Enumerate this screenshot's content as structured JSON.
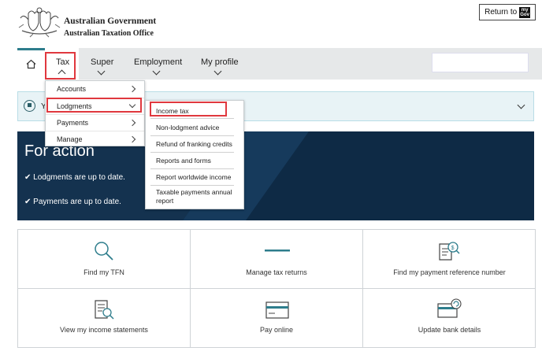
{
  "header": {
    "gov_line1": "Australian Government",
    "gov_line2": "Australian Taxation Office",
    "return_label": "Return to",
    "mygov_line1": "my",
    "mygov_line2": "Gov"
  },
  "nav": {
    "home_icon": "home-icon",
    "items": [
      {
        "label": "Tax"
      },
      {
        "label": "Super"
      },
      {
        "label": "Employment"
      },
      {
        "label": "My profile"
      }
    ],
    "search_value": ""
  },
  "alert": {
    "text": "Y"
  },
  "hero": {
    "title": "For action",
    "lines": [
      "Lodgments are up to date.",
      "Payments are up to date."
    ]
  },
  "tax_menu": {
    "items": [
      {
        "label": "Accounts"
      },
      {
        "label": "Lodgments"
      },
      {
        "label": "Payments"
      },
      {
        "label": "Manage"
      }
    ]
  },
  "lodgments_menu": {
    "items": [
      {
        "label": "Income tax"
      },
      {
        "label": "Non-lodgment advice"
      },
      {
        "label": "Refund of franking credits"
      },
      {
        "label": "Reports and forms"
      },
      {
        "label": "Report worldwide income"
      },
      {
        "label": "Taxable payments annual report"
      }
    ]
  },
  "tiles": [
    {
      "label": "Find my TFN",
      "icon": "magnifier-icon"
    },
    {
      "label": "Manage tax returns",
      "icon": "dash-icon"
    },
    {
      "label": "Find my payment reference number",
      "icon": "receipt-search-icon"
    },
    {
      "label": "View my income statements",
      "icon": "statement-search-icon"
    },
    {
      "label": "Pay online",
      "icon": "card-icon"
    },
    {
      "label": "Update bank details",
      "icon": "card-refresh-icon"
    }
  ],
  "colors": {
    "accent": "#2e7d8c",
    "hero_bg": "#0e2a45",
    "highlight": "#e0383e"
  }
}
